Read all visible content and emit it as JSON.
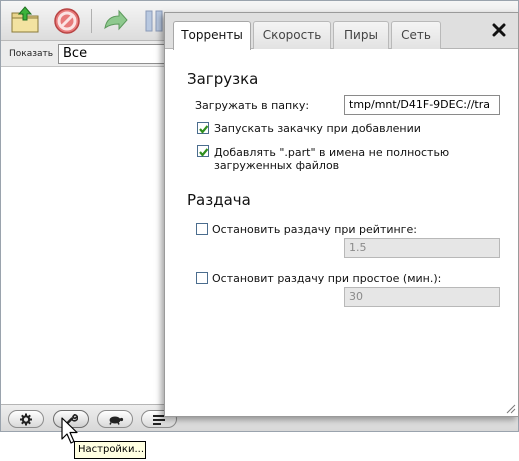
{
  "toolbar": {
    "buttons": [
      "open-torrent-icon",
      "remove-torrent-icon",
      "resume-torrent-icon",
      "pause-torrent-icon",
      "start-all-icon",
      "pause-all-icon"
    ]
  },
  "filter": {
    "label": "Показать",
    "value": "Все"
  },
  "bottom_bar": {
    "buttons": [
      "gear-icon",
      "wrench-icon",
      "turtle-icon",
      "sort-icon"
    ]
  },
  "tooltip": "Настройки...",
  "dialog": {
    "tabs": [
      {
        "label": "Торренты",
        "active": true
      },
      {
        "label": "Скорость",
        "active": false
      },
      {
        "label": "Пиры",
        "active": false
      },
      {
        "label": "Сеть",
        "active": false
      }
    ],
    "close_label": "✖",
    "download": {
      "heading": "Загрузка",
      "folder_label": "Загружать в папку:",
      "folder_value": "tmp/mnt/D41F-9DEC://tra",
      "start_on_add_label": "Запускать закачку при добавлении",
      "start_on_add_checked": true,
      "part_suffix_label_line1": "Добавлять \".part\" в имена не полностью",
      "part_suffix_label_line2": "загруженных файлов",
      "part_suffix_checked": true
    },
    "seeding": {
      "heading": "Раздача",
      "ratio_label": "Остановить раздачу при рейтинге:",
      "ratio_checked": false,
      "ratio_value": "1.5",
      "idle_label": "Остановит раздачу при простое (мин.):",
      "idle_checked": false,
      "idle_value": "30"
    }
  },
  "colors": {
    "dialog_tabbar": "#dfdfdf",
    "check_green": "#2f8f1f",
    "tooltip_bg": "#ffffe1"
  }
}
